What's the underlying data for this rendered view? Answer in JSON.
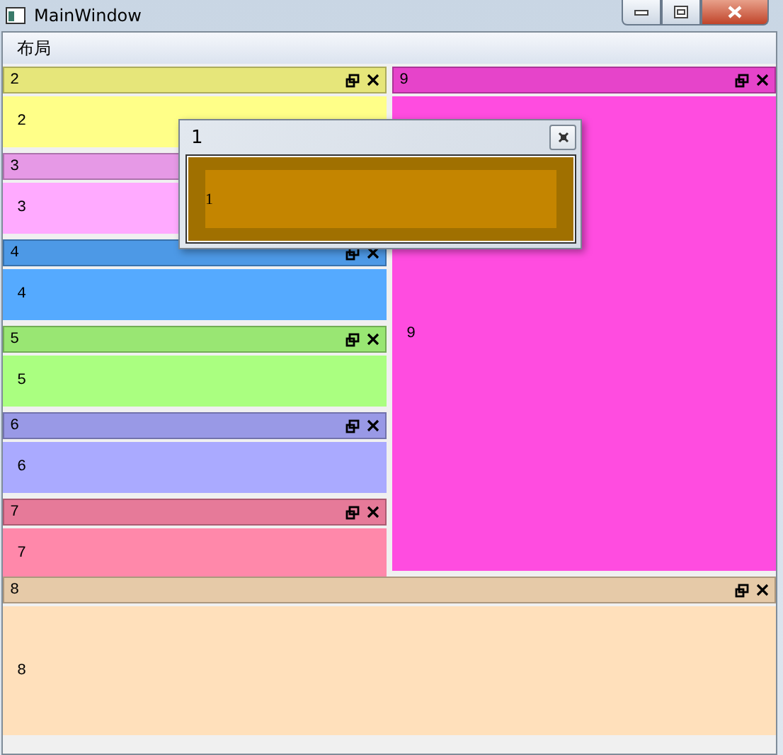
{
  "window": {
    "title": "MainWindow"
  },
  "menu": [
    "布局"
  ],
  "left_panels": [
    {
      "title": "2",
      "content": "2",
      "color": "#ffff88"
    },
    {
      "title": "3",
      "content": "3",
      "color": "#ffaaff",
      "controls_shown": false
    },
    {
      "title": "4",
      "content": "4",
      "color": "#55aaff"
    },
    {
      "title": "5",
      "content": "5",
      "color": "#aaff80"
    },
    {
      "title": "6",
      "content": "6",
      "color": "#aaaaff"
    },
    {
      "title": "7",
      "content": "7",
      "color": "#ff88aa"
    }
  ],
  "right_panel": {
    "title": "9",
    "content": "9",
    "color": "#ff4ce0"
  },
  "bottom_panel": {
    "title": "8",
    "content": "8",
    "color": "#ffe0bb"
  },
  "floating_window": {
    "title": "1",
    "content": "1"
  }
}
